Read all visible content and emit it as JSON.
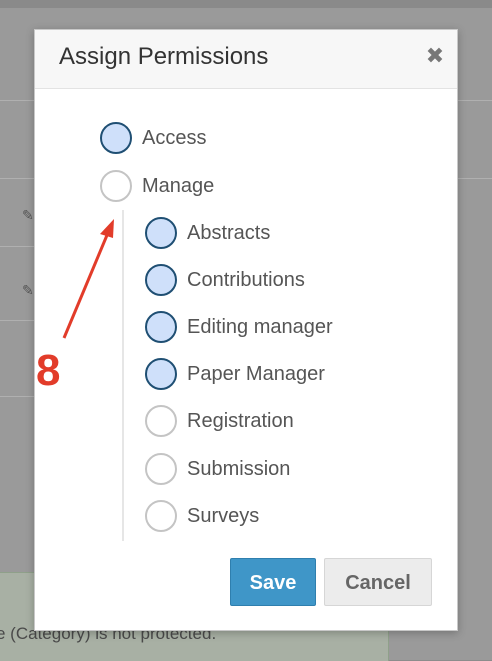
{
  "background": {
    "notice_text": "e (Category) is not protected."
  },
  "dialog": {
    "title": "Assign Permissions",
    "close_icon": "close-icon"
  },
  "permissions": [
    {
      "label": "Access",
      "checked": true
    },
    {
      "label": "Manage",
      "checked": false
    },
    {
      "label": "Abstracts",
      "checked": true
    },
    {
      "label": "Contributions",
      "checked": true
    },
    {
      "label": "Editing manager",
      "checked": true
    },
    {
      "label": "Paper Manager",
      "checked": true
    },
    {
      "label": "Registration",
      "checked": false
    },
    {
      "label": "Submission",
      "checked": false
    },
    {
      "label": "Surveys",
      "checked": false
    }
  ],
  "buttons": {
    "save": "Save",
    "cancel": "Cancel"
  },
  "annotation": {
    "step": "8",
    "color": "#e23c2a"
  },
  "colors": {
    "checked_fill": "#cfe0fa",
    "checked_border": "#1f4f73",
    "primary": "#3f96c8"
  }
}
